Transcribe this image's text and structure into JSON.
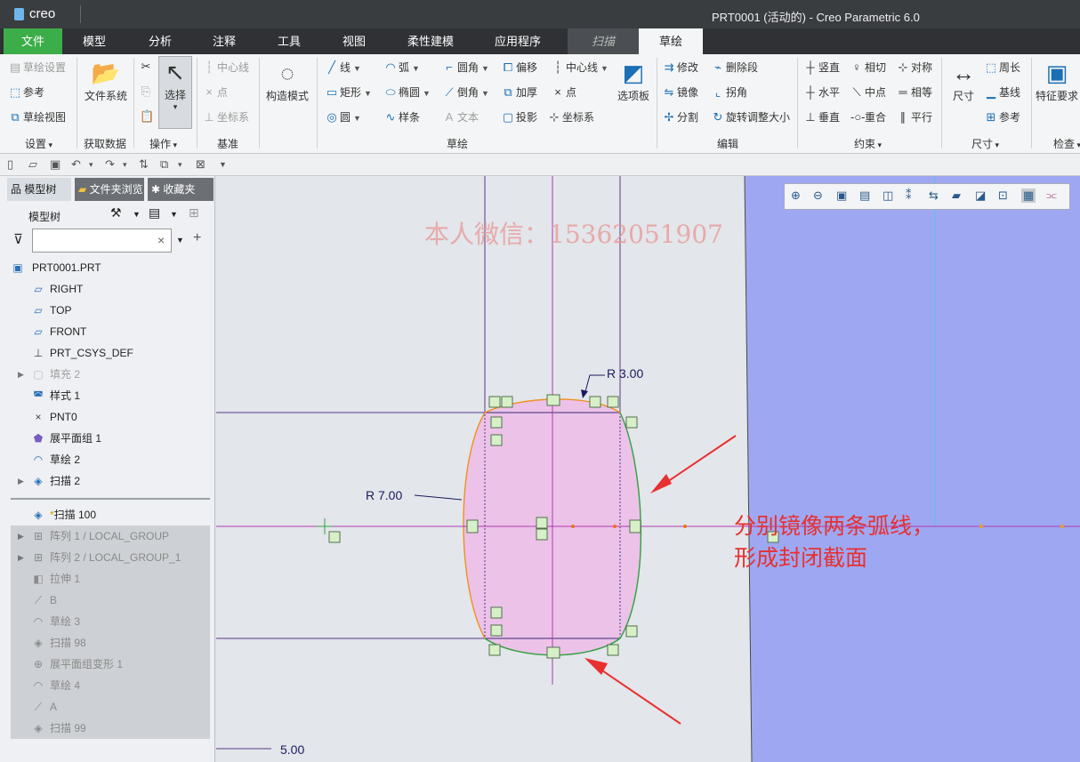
{
  "app": {
    "logo": "creo",
    "window_title": "PRT0001 (活动的) - Creo Parametric 6.0"
  },
  "menu_tabs": [
    "文件",
    "模型",
    "分析",
    "注释",
    "工具",
    "视图",
    "柔性建模",
    "应用程序",
    "扫描",
    "草绘"
  ],
  "ribbon": {
    "setup": {
      "items": [
        "草绘设置",
        "参考",
        "草绘视图"
      ],
      "label": "设置"
    },
    "get_data": {
      "items": [
        "文件系统"
      ],
      "label": "获取数据"
    },
    "operations": {
      "items": [
        "选择"
      ],
      "label": "操作"
    },
    "datum": {
      "items": [
        "中心线",
        "点",
        "坐标系"
      ],
      "label": "基准"
    },
    "construction_mode": "构造模式",
    "sketching": {
      "items": [
        "线",
        "弧",
        "圆角",
        "偏移",
        "中心线",
        "矩形",
        "椭圆",
        "倒角",
        "加厚",
        "点",
        "圆",
        "样条",
        "文本",
        "投影",
        "坐标系"
      ],
      "palette": "选项板",
      "label": "草绘"
    },
    "editing": {
      "items": [
        "修改",
        "删除段",
        "镜像",
        "拐角",
        "分割",
        "旋转调整大小"
      ],
      "label": "编辑"
    },
    "constrain": {
      "items": [
        "竖直",
        "相切",
        "对称",
        "水平",
        "中点",
        "相等",
        "垂直",
        "重合",
        "平行"
      ],
      "label": "约束"
    },
    "dimension": {
      "items": [
        "尺寸",
        "周长",
        "基线",
        "参考"
      ],
      "label": "尺寸"
    },
    "inspect": {
      "items": [
        "特征要求"
      ],
      "label": "检查"
    }
  },
  "panel": {
    "tabs": [
      "模型树",
      "文件夹浏览器",
      "收藏夹"
    ],
    "tree_header": "模型树",
    "filter_placeholder": "",
    "tree_items": [
      {
        "label": "PRT0001.PRT",
        "icon": "part-icon"
      },
      {
        "label": "RIGHT",
        "icon": "plane-icon"
      },
      {
        "label": "TOP",
        "icon": "plane-icon"
      },
      {
        "label": "FRONT",
        "icon": "plane-icon"
      },
      {
        "label": "PRT_CSYS_DEF",
        "icon": "csys-icon"
      },
      {
        "label": "填充 2",
        "icon": "fill-icon",
        "dim": true
      },
      {
        "label": "样式 1",
        "icon": "style-icon"
      },
      {
        "label": "PNT0",
        "icon": "point-icon"
      },
      {
        "label": "展平面组 1",
        "icon": "flatten-quilt-icon"
      },
      {
        "label": "草绘 2",
        "icon": "sketch-icon"
      },
      {
        "label": "扫描 2",
        "icon": "sweep-icon"
      }
    ],
    "current_item": "扫描 100",
    "suppressed_items": [
      {
        "label": "阵列 1 / LOCAL_GROUP",
        "icon": "pattern-icon"
      },
      {
        "label": "阵列 2 / LOCAL_GROUP_1",
        "icon": "pattern-icon"
      },
      {
        "label": "拉伸 1",
        "icon": "extrude-icon"
      },
      {
        "label": "B",
        "icon": "datum-curve-icon"
      },
      {
        "label": "草绘 3",
        "icon": "sketch-icon"
      },
      {
        "label": "扫描 98",
        "icon": "sweep-icon"
      },
      {
        "label": "展平面组变形 1",
        "icon": "flatten-deform-icon"
      },
      {
        "label": "草绘 4",
        "icon": "sketch-icon"
      },
      {
        "label": "A",
        "icon": "datum-curve-icon"
      },
      {
        "label": "扫描 99",
        "icon": "sweep-icon"
      }
    ]
  },
  "canvas": {
    "dimensions": [
      "R 3.00",
      "R 7.00",
      "5.00"
    ],
    "watermark": "本人微信：15362051907",
    "annotation_line1": "分别镜像两条弧线，",
    "annotation_line2": "形成封闭截面"
  },
  "colors": {
    "file_tab": "#3cae49",
    "canvas_bg": "#e3e6ea",
    "blue_region": "#9ea8f2",
    "section_fill": "#ecc2e8",
    "annotation": "#e83030"
  }
}
